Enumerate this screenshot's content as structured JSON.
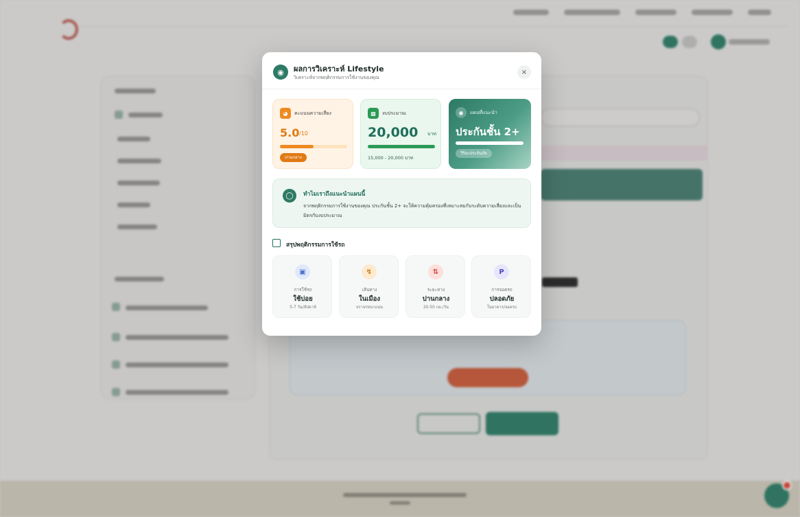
{
  "modal": {
    "title": "ผลการวิเคราะห์ Lifestyle",
    "subtitle": "วิเคราะห์จากพฤติกรรมการใช้งานของคุณ",
    "close_symbol": "×"
  },
  "risk": {
    "label": "คะแนนความเสี่ยง",
    "score": "5.0",
    "unit": "/10",
    "progress_fraction": 0.5,
    "level": "ปานกลาง"
  },
  "budget": {
    "label": "งบประมาณ",
    "amount": "20,000",
    "unit": "บาท",
    "range": "15,000 - 20,000 บาท"
  },
  "plan": {
    "label": "แผนที่แนะนำ",
    "name": "ประกันชั้น 2+",
    "badge": "วิริยะประกันภัย"
  },
  "why": {
    "title": "ทำไมเราถึงแนะนำแผนนี้",
    "body": "จากพฤติกรรมการใช้งานของคุณ ประกันชั้น 2+ จะให้ความคุ้มครองที่เหมาะสมกับระดับความเสี่ยงและเป็นมิตรกับงบประมาณ"
  },
  "summary": {
    "title": "สรุปพฤติกรรมการใช้รถ",
    "tiles": [
      {
        "label": "การใช้รถ",
        "value": "ใช้บ่อย",
        "sub": "5-7 วัน/สัปดาห์",
        "icon": "car-icon"
      },
      {
        "label": "เส้นทาง",
        "value": "ในเมือง",
        "sub": "จราจรหนาแน่น",
        "icon": "route-icon"
      },
      {
        "label": "ระยะทาง",
        "value": "ปานกลาง",
        "sub": "20-50 กม./วัน",
        "icon": "distance-icon"
      },
      {
        "label": "การจอดรถ",
        "value": "ปลอดภัย",
        "sub": "ในอาคาร/จอดรถ",
        "icon": "parking-icon"
      }
    ]
  },
  "colors": {
    "brand": "#2e7a65",
    "risk": "#ee8a22",
    "budget": "#2c9a55"
  }
}
